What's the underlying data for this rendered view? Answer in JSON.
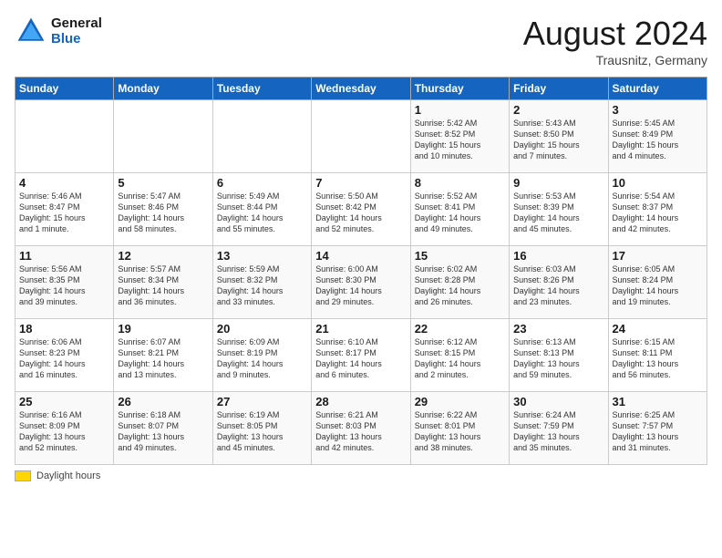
{
  "header": {
    "logo_line1": "General",
    "logo_line2": "Blue",
    "month": "August 2024",
    "location": "Trausnitz, Germany"
  },
  "weekdays": [
    "Sunday",
    "Monday",
    "Tuesday",
    "Wednesday",
    "Thursday",
    "Friday",
    "Saturday"
  ],
  "footer": {
    "daylight_label": "Daylight hours"
  },
  "weeks": [
    [
      {
        "day": "",
        "info": ""
      },
      {
        "day": "",
        "info": ""
      },
      {
        "day": "",
        "info": ""
      },
      {
        "day": "",
        "info": ""
      },
      {
        "day": "1",
        "info": "Sunrise: 5:42 AM\nSunset: 8:52 PM\nDaylight: 15 hours\nand 10 minutes."
      },
      {
        "day": "2",
        "info": "Sunrise: 5:43 AM\nSunset: 8:50 PM\nDaylight: 15 hours\nand 7 minutes."
      },
      {
        "day": "3",
        "info": "Sunrise: 5:45 AM\nSunset: 8:49 PM\nDaylight: 15 hours\nand 4 minutes."
      }
    ],
    [
      {
        "day": "4",
        "info": "Sunrise: 5:46 AM\nSunset: 8:47 PM\nDaylight: 15 hours\nand 1 minute."
      },
      {
        "day": "5",
        "info": "Sunrise: 5:47 AM\nSunset: 8:46 PM\nDaylight: 14 hours\nand 58 minutes."
      },
      {
        "day": "6",
        "info": "Sunrise: 5:49 AM\nSunset: 8:44 PM\nDaylight: 14 hours\nand 55 minutes."
      },
      {
        "day": "7",
        "info": "Sunrise: 5:50 AM\nSunset: 8:42 PM\nDaylight: 14 hours\nand 52 minutes."
      },
      {
        "day": "8",
        "info": "Sunrise: 5:52 AM\nSunset: 8:41 PM\nDaylight: 14 hours\nand 49 minutes."
      },
      {
        "day": "9",
        "info": "Sunrise: 5:53 AM\nSunset: 8:39 PM\nDaylight: 14 hours\nand 45 minutes."
      },
      {
        "day": "10",
        "info": "Sunrise: 5:54 AM\nSunset: 8:37 PM\nDaylight: 14 hours\nand 42 minutes."
      }
    ],
    [
      {
        "day": "11",
        "info": "Sunrise: 5:56 AM\nSunset: 8:35 PM\nDaylight: 14 hours\nand 39 minutes."
      },
      {
        "day": "12",
        "info": "Sunrise: 5:57 AM\nSunset: 8:34 PM\nDaylight: 14 hours\nand 36 minutes."
      },
      {
        "day": "13",
        "info": "Sunrise: 5:59 AM\nSunset: 8:32 PM\nDaylight: 14 hours\nand 33 minutes."
      },
      {
        "day": "14",
        "info": "Sunrise: 6:00 AM\nSunset: 8:30 PM\nDaylight: 14 hours\nand 29 minutes."
      },
      {
        "day": "15",
        "info": "Sunrise: 6:02 AM\nSunset: 8:28 PM\nDaylight: 14 hours\nand 26 minutes."
      },
      {
        "day": "16",
        "info": "Sunrise: 6:03 AM\nSunset: 8:26 PM\nDaylight: 14 hours\nand 23 minutes."
      },
      {
        "day": "17",
        "info": "Sunrise: 6:05 AM\nSunset: 8:24 PM\nDaylight: 14 hours\nand 19 minutes."
      }
    ],
    [
      {
        "day": "18",
        "info": "Sunrise: 6:06 AM\nSunset: 8:23 PM\nDaylight: 14 hours\nand 16 minutes."
      },
      {
        "day": "19",
        "info": "Sunrise: 6:07 AM\nSunset: 8:21 PM\nDaylight: 14 hours\nand 13 minutes."
      },
      {
        "day": "20",
        "info": "Sunrise: 6:09 AM\nSunset: 8:19 PM\nDaylight: 14 hours\nand 9 minutes."
      },
      {
        "day": "21",
        "info": "Sunrise: 6:10 AM\nSunset: 8:17 PM\nDaylight: 14 hours\nand 6 minutes."
      },
      {
        "day": "22",
        "info": "Sunrise: 6:12 AM\nSunset: 8:15 PM\nDaylight: 14 hours\nand 2 minutes."
      },
      {
        "day": "23",
        "info": "Sunrise: 6:13 AM\nSunset: 8:13 PM\nDaylight: 13 hours\nand 59 minutes."
      },
      {
        "day": "24",
        "info": "Sunrise: 6:15 AM\nSunset: 8:11 PM\nDaylight: 13 hours\nand 56 minutes."
      }
    ],
    [
      {
        "day": "25",
        "info": "Sunrise: 6:16 AM\nSunset: 8:09 PM\nDaylight: 13 hours\nand 52 minutes."
      },
      {
        "day": "26",
        "info": "Sunrise: 6:18 AM\nSunset: 8:07 PM\nDaylight: 13 hours\nand 49 minutes."
      },
      {
        "day": "27",
        "info": "Sunrise: 6:19 AM\nSunset: 8:05 PM\nDaylight: 13 hours\nand 45 minutes."
      },
      {
        "day": "28",
        "info": "Sunrise: 6:21 AM\nSunset: 8:03 PM\nDaylight: 13 hours\nand 42 minutes."
      },
      {
        "day": "29",
        "info": "Sunrise: 6:22 AM\nSunset: 8:01 PM\nDaylight: 13 hours\nand 38 minutes."
      },
      {
        "day": "30",
        "info": "Sunrise: 6:24 AM\nSunset: 7:59 PM\nDaylight: 13 hours\nand 35 minutes."
      },
      {
        "day": "31",
        "info": "Sunrise: 6:25 AM\nSunset: 7:57 PM\nDaylight: 13 hours\nand 31 minutes."
      }
    ]
  ]
}
